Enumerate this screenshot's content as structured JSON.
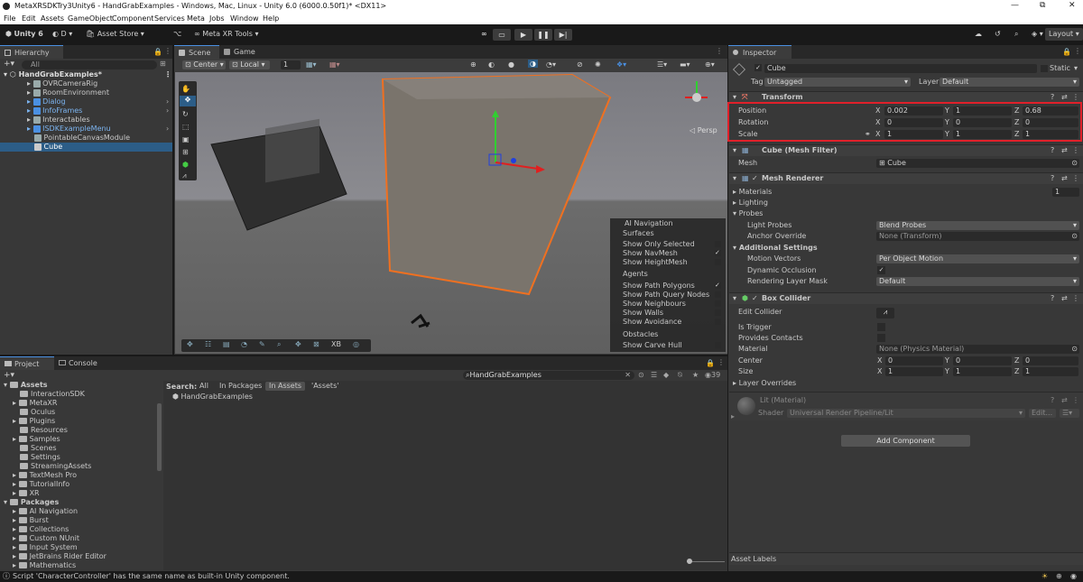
{
  "window": {
    "title": "MetaXRSDKTry3Unity6 - HandGrabExamples - Windows, Mac, Linux - Unity 6.0 (6000.0.50f1)* <DX11>",
    "minimize": "—",
    "maximize": "⧉",
    "close": "✕"
  },
  "menu": [
    "File",
    "Edit",
    "Assets",
    "GameObject",
    "Component",
    "Services",
    "Meta",
    "Jobs",
    "Window",
    "Help"
  ],
  "toolbar": {
    "unity": "Unity 6",
    "account": "D",
    "asset_store": "Asset Store",
    "meta_tools": "Meta XR Tools",
    "layout": "Layout"
  },
  "hierarchy": {
    "tab": "Hierarchy",
    "search": "All",
    "root": "HandGrabExamples*",
    "items": [
      "OVRCameraRig",
      "RoomEnvironment",
      "Dialog",
      "InfoFrames",
      "Interactables",
      "ISDKExampleMenu",
      "PointableCanvasModule",
      "Cube"
    ]
  },
  "scene": {
    "tabs": [
      "Scene",
      "Game"
    ],
    "pivot": "Center",
    "space": "Local",
    "grid": "1",
    "persp": "Persp",
    "overlay_xb": "XB"
  },
  "ai_nav": {
    "title": "AI Navigation",
    "surfaces": "Surfaces",
    "show_selected": "Show Only Selected",
    "show_navmesh": "Show NavMesh",
    "show_height": "Show HeightMesh",
    "agents": "Agents",
    "path_polys": "Show Path Polygons",
    "path_query": "Show Path Query Nodes",
    "neighbours": "Show Neighbours",
    "walls": "Show Walls",
    "avoidance": "Show Avoidance",
    "obstacles": "Obstacles",
    "carve": "Show Carve Hull"
  },
  "inspector": {
    "tab": "Inspector",
    "name": "Cube",
    "static": "Static",
    "tag_label": "Tag",
    "tag": "Untagged",
    "layer_label": "Layer",
    "layer": "Default",
    "transform": {
      "title": "Transform",
      "position": "Position",
      "rotation": "Rotation",
      "scale": "Scale",
      "px": "0.002",
      "py": "1",
      "pz": "0.68",
      "rx": "0",
      "ry": "0",
      "rz": "0",
      "sx": "1",
      "sy": "1",
      "sz": "1"
    },
    "mesh_filter": {
      "title": "Cube (Mesh Filter)",
      "mesh_label": "Mesh",
      "mesh": "Cube"
    },
    "mesh_renderer": {
      "title": "Mesh Renderer",
      "materials": "Materials",
      "materials_count": "1",
      "lighting": "Lighting",
      "probes": "Probes",
      "light_probes": "Light Probes",
      "light_probes_val": "Blend Probes",
      "anchor": "Anchor Override",
      "anchor_val": "None (Transform)",
      "additional": "Additional Settings",
      "motion": "Motion Vectors",
      "motion_val": "Per Object Motion",
      "dynamic": "Dynamic Occlusion",
      "layer_mask": "Rendering Layer Mask",
      "layer_mask_val": "Default"
    },
    "box_collider": {
      "title": "Box Collider",
      "edit": "Edit Collider",
      "trigger": "Is Trigger",
      "contacts": "Provides Contacts",
      "material": "Material",
      "material_val": "None (Physics Material)",
      "center": "Center",
      "cx": "0",
      "cy": "0",
      "cz": "0",
      "size": "Size",
      "zx": "1",
      "zy": "1",
      "zz": "1",
      "overrides": "Layer Overrides"
    },
    "material": {
      "name": "Lit (Material)",
      "shader_label": "Shader",
      "shader": "Universal Render Pipeline/Lit",
      "edit": "Edit..."
    },
    "add_component": "Add Component",
    "asset_labels": "Asset Labels",
    "x": "X",
    "y": "Y",
    "z": "Z"
  },
  "project": {
    "tabs": [
      "Project",
      "Console"
    ],
    "search": "HandGrabExamples",
    "count": "39",
    "search_label": "Search:",
    "filters": [
      "All",
      "In Packages",
      "In Assets",
      "'Assets'"
    ],
    "result": "HandGrabExamples",
    "tree": [
      "Assets",
      "InteractionSDK",
      "MetaXR",
      "Oculus",
      "Plugins",
      "Resources",
      "Samples",
      "Scenes",
      "Settings",
      "StreamingAssets",
      "TextMesh Pro",
      "TutorialInfo",
      "XR",
      "Packages",
      "AI Navigation",
      "Burst",
      "Collections",
      "Custom NUnit",
      "Input System",
      "JetBrains Rider Editor",
      "Mathematics"
    ]
  },
  "status": "Script 'CharacterController' has the same name as built-in Unity component.",
  "colors": {
    "selection": "#2c5d87",
    "highlight_box": "#e0202a",
    "accent": "#4a90e2"
  }
}
